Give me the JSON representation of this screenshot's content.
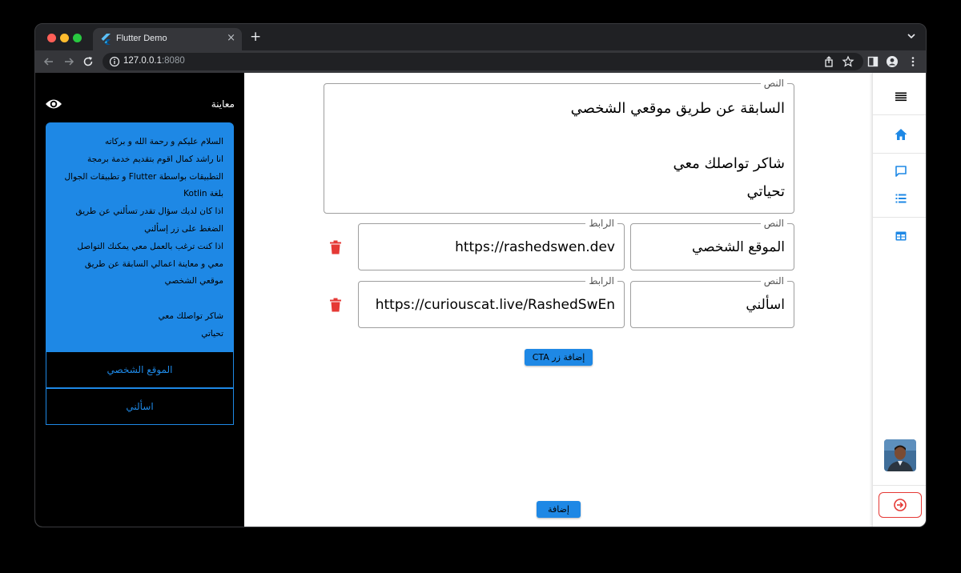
{
  "browser": {
    "tab_title": "Flutter Demo",
    "tab_close": "×",
    "new_tab": "+",
    "url_host": "127.0.0.1",
    "url_port": ":8080"
  },
  "preview": {
    "title": "معاينة",
    "message_lines": [
      "السلام عليكم و رحمة الله و بركاته",
      "انا راشد كمال اقوم بتقديم خدمة برمجة",
      "التطبيقات بواسطة Flutter و تطبيقات الجوال",
      "بلغة Kotlin",
      "اذا كان لديك سؤال تقدر تسألني عن طريق",
      "الضغط على زر إسألني",
      "اذا كنت ترغب بالعمل معي يمكنك التواصل",
      "معي و معاينة اعمالي السابقة عن طريق",
      "موقعي الشخصي",
      "",
      "شاكر تواصلك معي",
      "تحياتي"
    ],
    "cta_buttons": [
      "الموقع الشخصي",
      "اسألني"
    ]
  },
  "editor": {
    "body": {
      "label": "النص",
      "lines": [
        "السابقة عن طريق موقعي الشخصي",
        "",
        "شاكر تواصلك معي",
        "تحياتي"
      ]
    },
    "ctas": [
      {
        "text_label": "النص",
        "text": "الموقع الشخصي",
        "link_label": "الرابط",
        "link": "https://rashedswen.dev"
      },
      {
        "text_label": "النص",
        "text": "اسألني",
        "link_label": "الرابط",
        "link": "https://curiouscat.live/RashedSwEn"
      }
    ],
    "add_cta_label": "إضافة زر CTA",
    "add_label": "إضافة"
  },
  "colors": {
    "accent": "#1e88e5",
    "danger": "#e53935"
  },
  "icons": {
    "eye": "eye-icon",
    "trash": "trash-icon",
    "menu": "menu-icon",
    "home": "home-icon",
    "message": "message-icon",
    "list": "list-icon",
    "table": "table-icon",
    "logout": "logout-icon"
  }
}
